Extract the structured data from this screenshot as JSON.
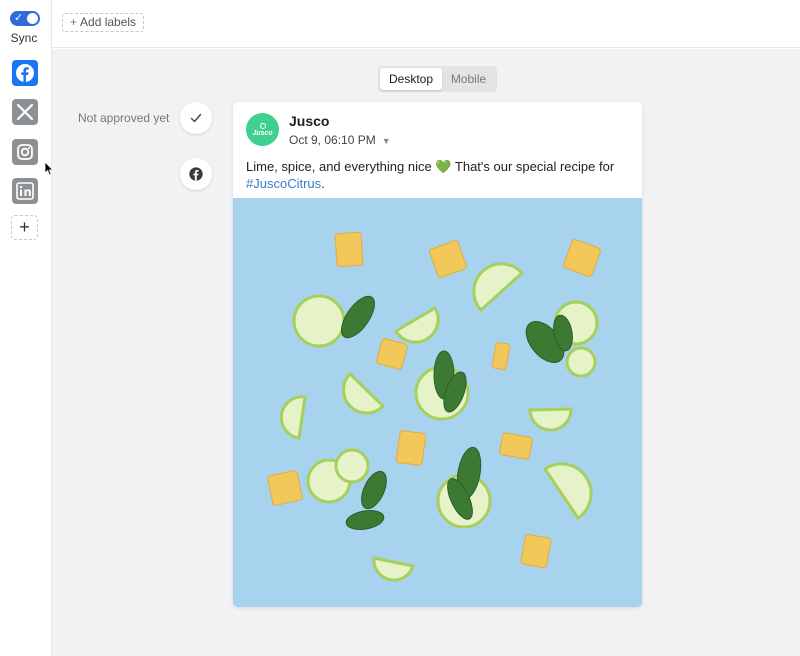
{
  "sidebar": {
    "sync_label": "Sync",
    "networks": [
      {
        "name": "Facebook",
        "icon": "facebook-icon",
        "active": true
      },
      {
        "name": "X",
        "icon": "x-icon",
        "active": false
      },
      {
        "name": "Instagram",
        "icon": "instagram-icon",
        "active": false
      },
      {
        "name": "LinkedIn",
        "icon": "linkedin-icon",
        "active": false
      }
    ],
    "add_label": "+"
  },
  "topbar": {
    "add_labels": "Add labels",
    "add_plus": "+"
  },
  "preview_toggle": {
    "options": [
      "Desktop",
      "Mobile"
    ],
    "selected": "Desktop"
  },
  "approval": {
    "status": "Not approved yet"
  },
  "post": {
    "account_name": "Jusco",
    "avatar_text": "Jusco",
    "date": "Oct 9, 06:10 PM",
    "text_main": "Lime, spice, and everything nice ",
    "emoji": "💚",
    "text_after": " That's our special recipe for",
    "hashtag": "#JuscoCitrus",
    "text_end": "."
  },
  "colors": {
    "accent": "#2f6bdb",
    "facebook": "#1877f2",
    "avatar": "#3fcf8e",
    "image_bg": "#a8d3ee",
    "hashtag": "#3d79c9"
  }
}
